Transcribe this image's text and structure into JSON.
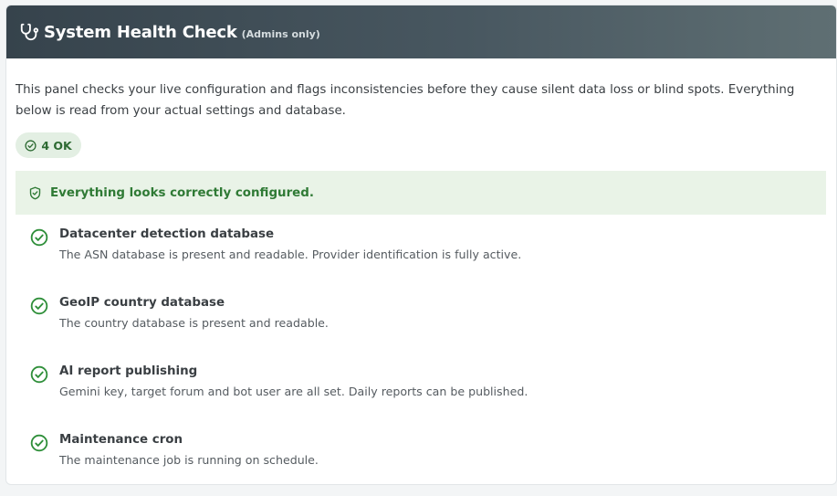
{
  "header": {
    "icon": "stethoscope-icon",
    "title": "System Health Check",
    "subtitle": "(Admins only)"
  },
  "intro": "This panel checks your live configuration and flags inconsistencies before they cause silent data loss or blind spots. Everything below is read from your actual settings and database.",
  "summary_badge": {
    "icon": "check-circle-icon",
    "label": "4 OK"
  },
  "banner": {
    "icon": "shield-check-icon",
    "text": "Everything looks correctly configured."
  },
  "checks": [
    {
      "status": "ok",
      "icon": "check-circle-icon",
      "name": "Datacenter detection database",
      "description": "The ASN database is present and readable. Provider identification is fully active."
    },
    {
      "status": "ok",
      "icon": "check-circle-icon",
      "name": "GeoIP country database",
      "description": "The country database is present and readable."
    },
    {
      "status": "ok",
      "icon": "check-circle-icon",
      "name": "AI report publishing",
      "description": "Gemini key, target forum and bot user are all set. Daily reports can be published."
    },
    {
      "status": "ok",
      "icon": "check-circle-icon",
      "name": "Maintenance cron",
      "description": "The maintenance job is running on schedule."
    }
  ],
  "colors": {
    "ok_green": "#2f7a35",
    "banner_bg": "#e9f3e7",
    "header_dark": "#36434c"
  }
}
